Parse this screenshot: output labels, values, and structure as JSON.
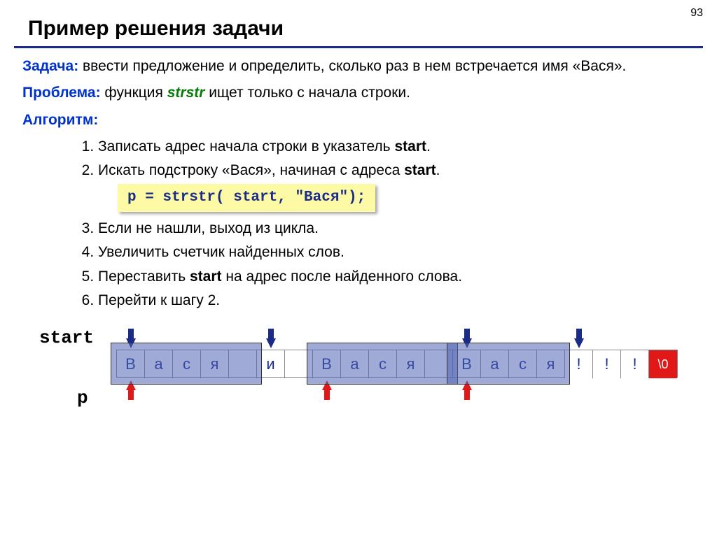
{
  "page_number": "93",
  "title": "Пример решения задачи",
  "task": {
    "label": "Задача:",
    "text": " ввести предложение и определить, сколько раз в нем встречается имя «Вася»."
  },
  "problem": {
    "label": "Проблема:",
    "pre": " функция ",
    "fn": "strstr",
    "post": " ищет только с начала строки."
  },
  "algorithm_label": "Алгоритм:",
  "steps": {
    "s1_a": "Записать адрес начала строки в указатель ",
    "s1_b": "start",
    "s1_c": ".",
    "s2_a": "Искать подстроку «Вася», начиная с адреса ",
    "s2_b": "start",
    "s2_c": ".",
    "code": "p = strstr( start, \"Вася\");",
    "s3": "Если не нашли, выход из цикла.",
    "s4": "Увеличить счетчик найденных слов.",
    "s5_a": "Переставить ",
    "s5_b": "start",
    "s5_c": " на адрес после найденного слова.",
    "s6": "Перейти к шагу 2."
  },
  "diagram": {
    "start_label": "start",
    "p_label": "p",
    "cells": [
      "В",
      "а",
      "с",
      "я",
      " ",
      "и",
      " ",
      "В",
      "а",
      "с",
      "я",
      " ",
      "В",
      "а",
      "с",
      "я",
      "!",
      "!",
      "!",
      "\\0"
    ]
  }
}
